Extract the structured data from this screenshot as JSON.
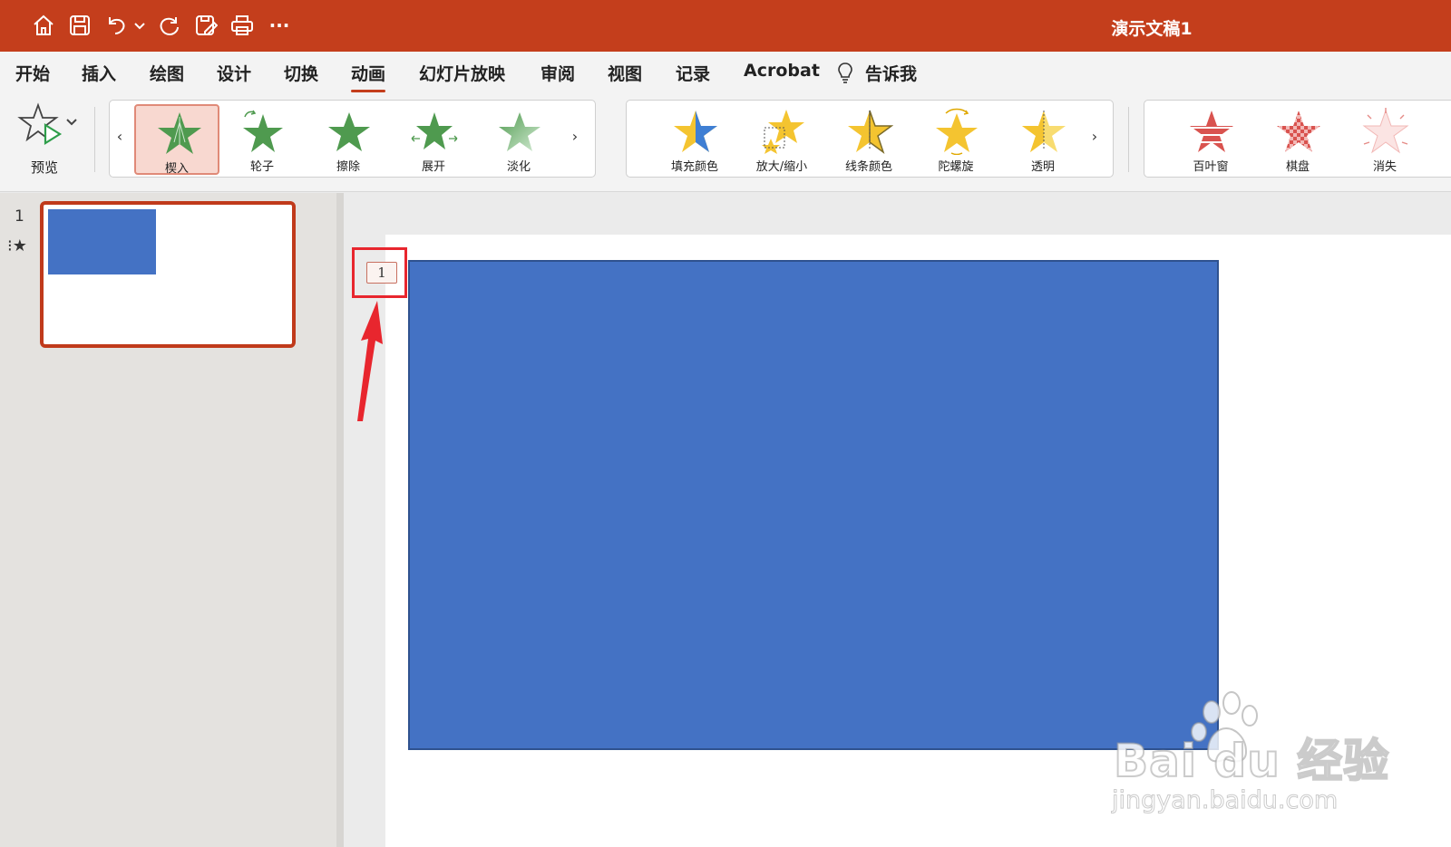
{
  "app": {
    "document_title": "演示文稿1",
    "accent_color": "#c43e1c"
  },
  "toolbar": {
    "icons": [
      "home-icon",
      "save-icon",
      "undo-icon",
      "undo-dropdown-icon",
      "redo-icon",
      "save-as-icon",
      "print-icon",
      "more-icon"
    ],
    "more_label": "···"
  },
  "menu": {
    "tabs": [
      {
        "label": "开始"
      },
      {
        "label": "插入"
      },
      {
        "label": "绘图"
      },
      {
        "label": "设计"
      },
      {
        "label": "切换"
      },
      {
        "label": "动画",
        "active": true
      },
      {
        "label": "幻灯片放映"
      },
      {
        "label": "审阅"
      },
      {
        "label": "视图"
      },
      {
        "label": "记录"
      },
      {
        "label": "Acrobat"
      }
    ],
    "tell_me": "告诉我"
  },
  "ribbon": {
    "preview_label": "预览",
    "entrance_effects": [
      {
        "label": "楔入",
        "selected": true,
        "color": "#4f9a4f"
      },
      {
        "label": "轮子",
        "color": "#4f9a4f"
      },
      {
        "label": "擦除",
        "color": "#4f9a4f"
      },
      {
        "label": "展开",
        "color": "#4f9a4f"
      },
      {
        "label": "淡化",
        "color": "#7fbf7f"
      }
    ],
    "emphasis_effects": [
      {
        "label": "填充颜色",
        "color": "#f4c430"
      },
      {
        "label": "放大/缩小",
        "color": "#f4c430"
      },
      {
        "label": "线条颜色",
        "color": "#f4c430"
      },
      {
        "label": "陀螺旋",
        "color": "#f4c430"
      },
      {
        "label": "透明",
        "color": "#f8dc70"
      }
    ],
    "exit_effects": [
      {
        "label": "百叶窗",
        "color": "#d9534f"
      },
      {
        "label": "棋盘",
        "color": "#d9534f"
      },
      {
        "label": "消失",
        "color": "#f2b8b6"
      }
    ],
    "prev_arrow": "‹",
    "next_arrow": "›"
  },
  "slides_pane": {
    "slide_number": "1",
    "animation_marker": "⁝★",
    "shape_color": "#4472c4"
  },
  "editor": {
    "animation_order_tag": "1",
    "shape_fill": "#4472c4"
  },
  "watermark": {
    "brand": "Bai du 经验",
    "url": "jingyan.baidu.com"
  }
}
